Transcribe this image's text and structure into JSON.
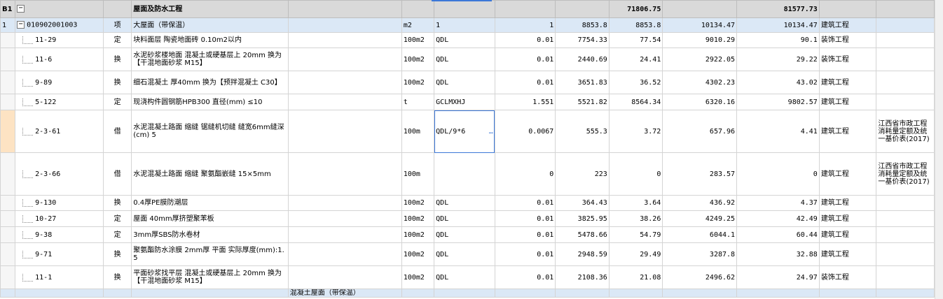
{
  "group": {
    "code": "B1",
    "expander": "−",
    "name": "屋面及防水工程",
    "total1": "71806.75",
    "total2": "81577.73"
  },
  "item": {
    "rownum": "1",
    "expander": "−",
    "code": "010902001003",
    "type": "项",
    "name": "大屋面（带保温）",
    "unit": "m2",
    "qty_expr": "1",
    "qty": "1",
    "price": "8853.8",
    "amount": "8853.8",
    "price2": "10134.47",
    "amount2": "10134.47",
    "category": "建筑工程"
  },
  "rows": [
    {
      "code": "11-29",
      "type": "定",
      "name": "块料面层 陶瓷地面砖 0.10m2以内",
      "unit": "100m2",
      "qty_expr": "QDL",
      "qty": "0.01",
      "price": "7754.33",
      "amount": "77.54",
      "price2": "9010.29",
      "amount2": "90.1",
      "category": "装饰工程",
      "note": ""
    },
    {
      "code": "11-6",
      "type": "换",
      "name": "水泥砂浆楼地面 混凝土或硬基层上 20mm 换为【干混地面砂浆 M15】",
      "unit": "100m2",
      "qty_expr": "QDL",
      "qty": "0.01",
      "price": "2440.69",
      "amount": "24.41",
      "price2": "2922.05",
      "amount2": "29.22",
      "category": "装饰工程",
      "note": ""
    },
    {
      "code": "9-89",
      "type": "换",
      "name": "细石混凝土 厚40mm 换为【预拌混凝土 C30】",
      "unit": "100m2",
      "qty_expr": "QDL",
      "qty": "0.01",
      "price": "3651.83",
      "amount": "36.52",
      "price2": "4302.23",
      "amount2": "43.02",
      "category": "建筑工程",
      "note": ""
    },
    {
      "code": "5-122",
      "type": "定",
      "name": "现浇构件圆钢筋HPB300 直径(mm) ≤10",
      "unit": "t",
      "qty_expr": "GCLMXHJ",
      "qty": "1.551",
      "price": "5521.82",
      "amount": "8564.34",
      "price2": "6320.16",
      "amount2": "9802.57",
      "category": "建筑工程",
      "note": ""
    },
    {
      "code": "2-3-61",
      "type": "借",
      "name": "水泥混凝土路面 缩缝 锯缝机切缝 缝宽6mm缝深(cm) 5",
      "unit": "100m",
      "qty_expr": "QDL/9*6",
      "qty": "0.0067",
      "price": "555.3",
      "amount": "3.72",
      "price2": "657.96",
      "amount2": "4.41",
      "category": "建筑工程",
      "note": "江西省市政工程消耗量定额及统一基价表(2017)"
    },
    {
      "code": "2-3-66",
      "type": "借",
      "name": "水泥混凝土路面 缩缝 聚氨酯嵌缝 15×5mm",
      "unit": "100m",
      "qty_expr": "",
      "qty": "0",
      "price": "223",
      "amount": "0",
      "price2": "283.57",
      "amount2": "0",
      "category": "建筑工程",
      "note": "江西省市政工程消耗量定额及统一基价表(2017)"
    },
    {
      "code": "9-130",
      "type": "换",
      "name": "0.4厚PE膜防潮层",
      "unit": "100m2",
      "qty_expr": "QDL",
      "qty": "0.01",
      "price": "364.43",
      "amount": "3.64",
      "price2": "436.92",
      "amount2": "4.37",
      "category": "建筑工程",
      "note": ""
    },
    {
      "code": "10-27",
      "type": "定",
      "name": "屋面 40mm厚挤塑聚苯板",
      "unit": "100m2",
      "qty_expr": "QDL",
      "qty": "0.01",
      "price": "3825.95",
      "amount": "38.26",
      "price2": "4249.25",
      "amount2": "42.49",
      "category": "建筑工程",
      "note": ""
    },
    {
      "code": "9-38",
      "type": "定",
      "name": "3mm厚SBS防水卷材",
      "unit": "100m2",
      "qty_expr": "QDL",
      "qty": "0.01",
      "price": "5478.66",
      "amount": "54.79",
      "price2": "6044.1",
      "amount2": "60.44",
      "category": "建筑工程",
      "note": ""
    },
    {
      "code": "9-71",
      "type": "换",
      "name": "聚氨酯防水涂膜 2mm厚 平面 实际厚度(mm):1.5",
      "unit": "100m2",
      "qty_expr": "QDL",
      "qty": "0.01",
      "price": "2948.59",
      "amount": "29.49",
      "price2": "3287.8",
      "amount2": "32.88",
      "category": "建筑工程",
      "note": ""
    },
    {
      "code": "11-1",
      "type": "换",
      "name": "平面砂浆找平层 混凝土或硬基层上 20mm 换为【干混地面砂浆 M15】",
      "unit": "100m2",
      "qty_expr": "QDL",
      "qty": "0.01",
      "price": "2108.36",
      "amount": "21.08",
      "price2": "2496.62",
      "amount2": "24.97",
      "category": "装饰工程",
      "note": ""
    }
  ],
  "partial": {
    "text": "混凝土屋面（带保温）"
  },
  "selection_ellipsis": "…"
}
